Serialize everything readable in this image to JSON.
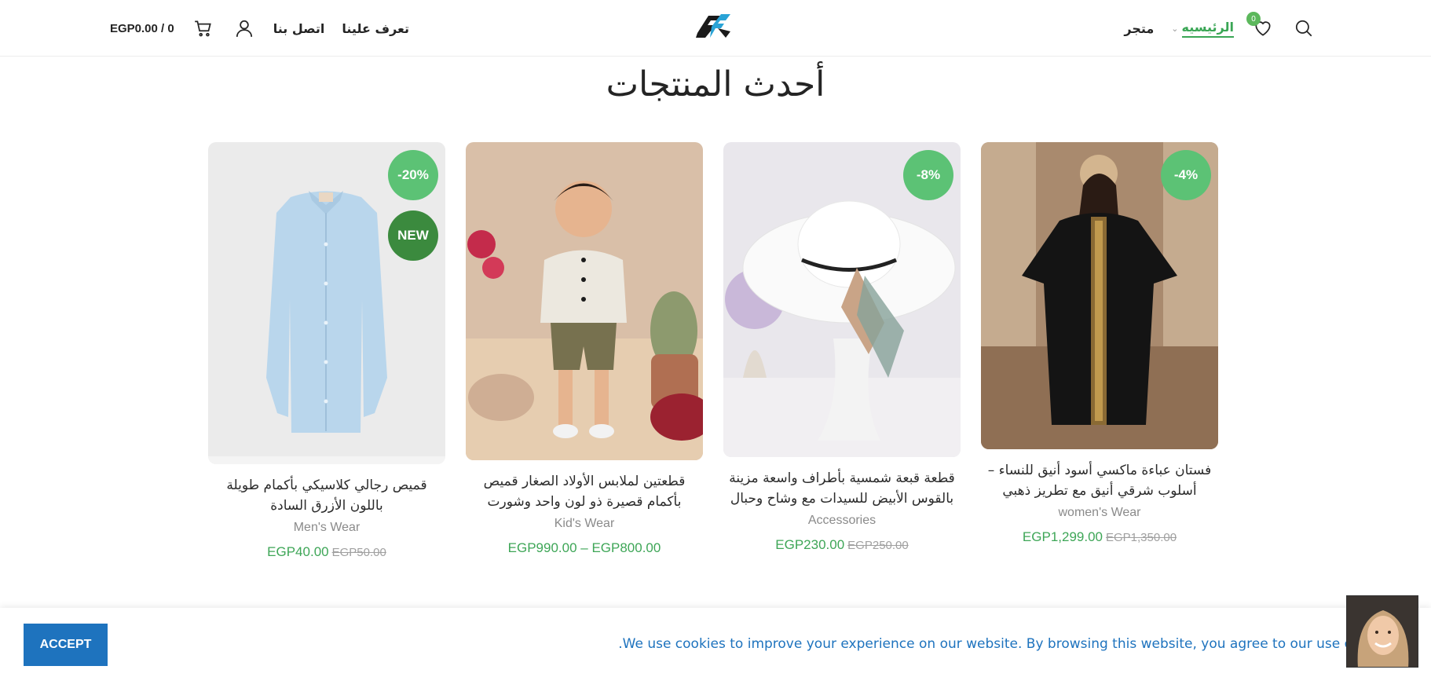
{
  "header": {
    "cart_total": "EGP0.00 / 0",
    "nav_about": "تعرف علينا",
    "nav_contact": "اتصل بنا",
    "nav_home": "الرئيسيه",
    "nav_shop": "متجر",
    "wishlist_count": "0",
    "logo_text": "SF",
    "icons": [
      "cart-icon",
      "user-icon",
      "heart-icon",
      "search-icon"
    ]
  },
  "section": {
    "title": "أحدث المنتجات"
  },
  "products": [
    {
      "title": "قميص رجالي كلاسيكي بأكمام طويلة باللون الأزرق السادة",
      "category": "Men's Wear",
      "price": "EGP40.00",
      "old_price": "EGP50.00",
      "badge_sale": "-20%",
      "badge_new": "NEW"
    },
    {
      "title": "قطعتين لملابس الأولاد الصغار قميص بأكمام قصيرة ذو لون واحد وشورت",
      "category": "Kid's Wear",
      "price": "EGP990.00 – EGP800.00"
    },
    {
      "title": "قطعة قبعة شمسية بأطراف واسعة مزينة بالقوس الأبيض للسيدات مع وشاح وحبال",
      "category": "Accessories",
      "price": "EGP230.00",
      "old_price": "EGP250.00",
      "badge_sale": "-8%"
    },
    {
      "title": "فستان عباءة ماكسي أسود أنيق للنساء – أسلوب شرقي أنيق مع تطريز ذهبي",
      "category": "women's Wear",
      "price": "EGP1,299.00",
      "old_price": "EGP1,350.00",
      "badge_sale": "-4%"
    }
  ],
  "cookie": {
    "accept_label": "ACCEPT",
    "message": ".We use cookies to improve your experience on our website. By browsing this website, you agree to our use o"
  },
  "colors": {
    "accent_green": "#3ea657",
    "badge_green": "#5cc275",
    "new_badge": "#3b8a3e",
    "cookie_blue": "#1e73be"
  }
}
